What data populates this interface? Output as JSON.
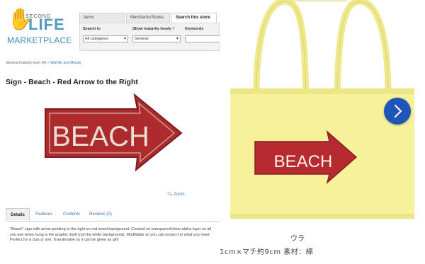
{
  "left": {
    "logo": {
      "second": "SECOND",
      "life": "LIFE",
      "marketplace": "MARKETPLACE"
    },
    "search": {
      "tabs": [
        "Items",
        "Merchants/Stores",
        "Search this store"
      ],
      "labels": {
        "search_in": "Search in",
        "maturity": "Show maturity levels",
        "keywords": "Keywords"
      },
      "search_in_value": "All categories",
      "maturity_value": "General",
      "maturity_help": "?"
    },
    "breadcrumb": {
      "prefix": "General maturity level:",
      "l1": "Art",
      "sep": "»",
      "l2": "Wall Art and Murals"
    },
    "title": "Sign - Beach - Red Arrow to the Right",
    "sign_text": "BEACH",
    "zoom": "Zoom",
    "tabs": [
      "Details",
      "Features",
      "Contents",
      "Reviews (0)"
    ],
    "description": "\"Beach\" sign with arrow pointing to the right on red wood background. Created on transparent/clear alpha layer so all you see when hung is the graphic itself (not the white background). Modifiable so you can resize it to what you need. Perfect for a club or sim. Transferable so it can be given as gift!"
  },
  "right": {
    "bag_sign_text": "BEACH",
    "caption_back": "ウラ",
    "caption_size": "1cm×マチ約9cm 素材：綿",
    "colors": {
      "bag": "#f6f19a",
      "sign": "#b72a2f",
      "next_button": "#1e56b8"
    }
  }
}
